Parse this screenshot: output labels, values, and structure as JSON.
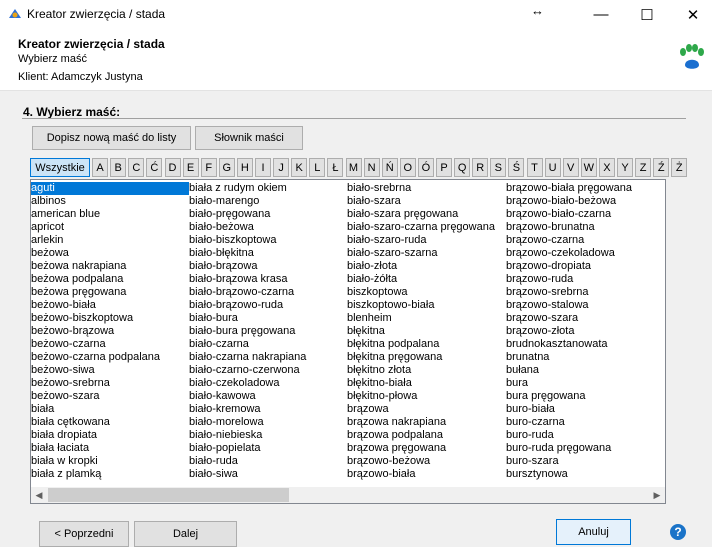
{
  "window": {
    "title": "Kreator zwierzęcia / stada",
    "app_icon": "app-logo-icon",
    "resize_icon": "↔",
    "minimize": "—",
    "maximize": "☐",
    "close": "✕"
  },
  "header": {
    "title": "Kreator zwierzęcia / stada",
    "subtitle": "Wybierz maść",
    "client": "Klient:  Adamczyk  Justyna"
  },
  "section": {
    "label": "4. Wybierz maść:"
  },
  "toolbar": {
    "add_label": "Dopisz nową maść do listy",
    "dictionary_label": "Słownik maści"
  },
  "letters": [
    "Wszystkie",
    "A",
    "B",
    "C",
    "Ć",
    "D",
    "E",
    "F",
    "G",
    "H",
    "I",
    "J",
    "K",
    "L",
    "Ł",
    "M",
    "N",
    "Ń",
    "O",
    "Ó",
    "P",
    "Q",
    "R",
    "S",
    "Ś",
    "T",
    "U",
    "V",
    "W",
    "X",
    "Y",
    "Z",
    "Ź",
    "Ż"
  ],
  "active_letter": "Wszystkie",
  "list": {
    "selected": "aguti",
    "columns": [
      [
        "aguti",
        "albinos",
        "american blue",
        "apricot",
        "arlekin",
        "beżowa",
        "beżowa nakrapiana",
        "beżowa podpalana",
        "beżowa pręgowana",
        "beżowo-biała",
        "beżowo-biszkoptowa",
        "beżowo-brązowa",
        "beżowo-czarna",
        "beżowo-czarna podpalana",
        "beżowo-siwa",
        "beżowo-srebrna",
        "beżowo-szara",
        "biała",
        "biała cętkowana",
        "biała dropiata",
        "biała łaciata",
        "biała w kropki",
        "biała z plamką"
      ],
      [
        "biała z rudym okiem",
        "biało-marengo",
        "biało-pręgowana",
        "biało-beżowa",
        "biało-biszkoptowa",
        "biało-błękitna",
        "biało-brązowa",
        "biało-brązowa krasa",
        "biało-brązowo-czarna",
        "biało-brązowo-ruda",
        "biało-bura",
        "biało-bura pręgowana",
        "biało-czarna",
        "biało-czarna nakrapiana",
        "biało-czarno-czerwona",
        "biało-czekoladowa",
        "biało-kawowa",
        "biało-kremowa",
        "biało-morelowa",
        "biało-niebieska",
        "biało-popielata",
        "biało-ruda",
        "biało-siwa"
      ],
      [
        "biało-srebrna",
        "biało-szara",
        "biało-szara pręgowana",
        "biało-szaro-czarna pręgowana",
        "biało-szaro-ruda",
        "biało-szaro-szarna",
        "biało-złota",
        "biało-żółta",
        "biszkoptowa",
        "biszkoptowo-biała",
        "blenheim",
        "błękitna",
        "błękitna podpalana",
        "błękitna pręgowana",
        "błękitno złota",
        "błękitno-biała",
        "błękitno-płowa",
        "brązowa",
        "brązowa nakrapiana",
        "brązowa podpalana",
        "brązowa pręgowana",
        "brązowo-beżowa",
        "brązowo-biała"
      ],
      [
        "brązowo-biała pręgowana",
        "brązowo-biało-beżowa",
        "brązowo-biało-czarna",
        "brązowo-brunatna",
        "brązowo-czarna",
        "brązowo-czekoladowa",
        "brązowo-dropiata",
        "brązowo-ruda",
        "brązowo-srebrna",
        "brązowo-stalowa",
        "brązowo-szara",
        "brązowo-złota",
        "brudnokasztanowata",
        "brunatna",
        "bułana",
        "bura",
        "bura pręgowana",
        "buro-biała",
        "buro-czarna",
        "buro-ruda",
        "buro-ruda pręgowana",
        "buro-szara",
        "bursztynowa"
      ]
    ]
  },
  "footer": {
    "prev_label": "< Poprzedni",
    "next_label": "Dalej",
    "cancel_label": "Anuluj",
    "help": "?"
  }
}
